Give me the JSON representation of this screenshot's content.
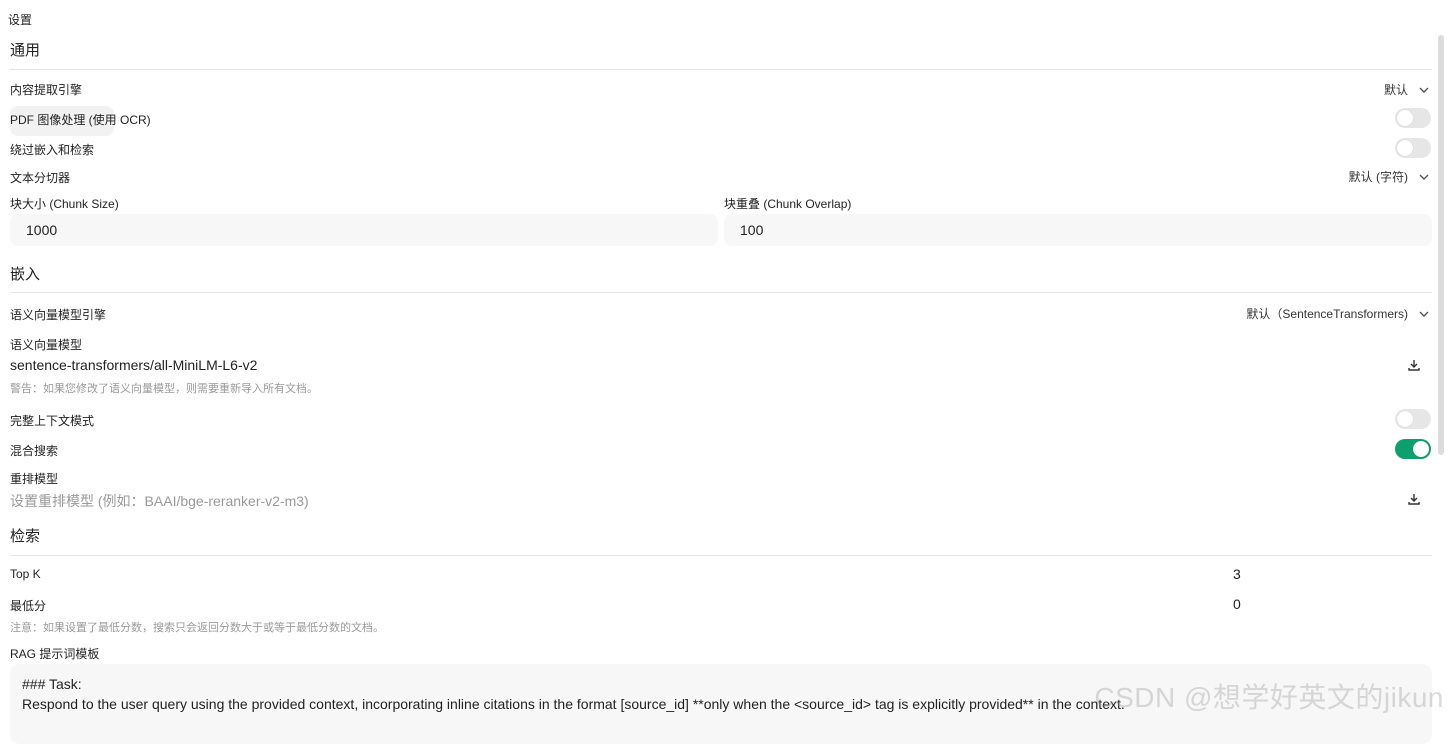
{
  "page": {
    "title": "设置"
  },
  "sections": {
    "general": "通用",
    "embedding": "嵌入",
    "retrieval": "检索"
  },
  "general": {
    "content_engine_label": "内容提取引擎",
    "content_engine_value": "默认",
    "pdf_ocr_label": "PDF 图像处理 (使用 OCR)",
    "bypass_label": "绕过嵌入和检索",
    "splitter_label": "文本分切器",
    "splitter_value": "默认 (字符)",
    "chunk_size_label": "块大小 (Chunk Size)",
    "chunk_size_value": "1000",
    "chunk_overlap_label": "块重叠 (Chunk Overlap)",
    "chunk_overlap_value": "100"
  },
  "embedding": {
    "engine_label": "语义向量模型引擎",
    "engine_value": "默认（SentenceTransformers)",
    "model_label": "语义向量模型",
    "model_value": "sentence-transformers/all-MiniLM-L6-v2",
    "model_warning": "警告：如果您修改了语义向量模型，则需要重新导入所有文档。",
    "full_context_label": "完整上下文模式",
    "hybrid_search_label": "混合搜索",
    "rerank_label": "重排模型",
    "rerank_placeholder": "设置重排模型 (例如：BAAI/bge-reranker-v2-m3)"
  },
  "retrieval": {
    "topk_label": "Top K",
    "topk_value": "3",
    "min_score_label": "最低分",
    "min_score_value": "0",
    "min_score_note": "注意：如果设置了最低分数，搜索只会返回分数大于或等于最低分数的文档。",
    "rag_template_label": "RAG 提示词模板",
    "rag_template_line1": "### Task:",
    "rag_template_line2": "Respond to the user query using the provided context, incorporating inline citations in the format [source_id] **only when the <source_id> tag is explicitly provided** in the context."
  },
  "toggles": {
    "pdf_ocr": false,
    "bypass": false,
    "full_context": false,
    "hybrid_search": true
  },
  "colors": {
    "accent": "#0e9f6e"
  },
  "icons": [
    "chevron-down-icon",
    "download-icon"
  ],
  "watermark": "CSDN @想学好英文的jikun"
}
